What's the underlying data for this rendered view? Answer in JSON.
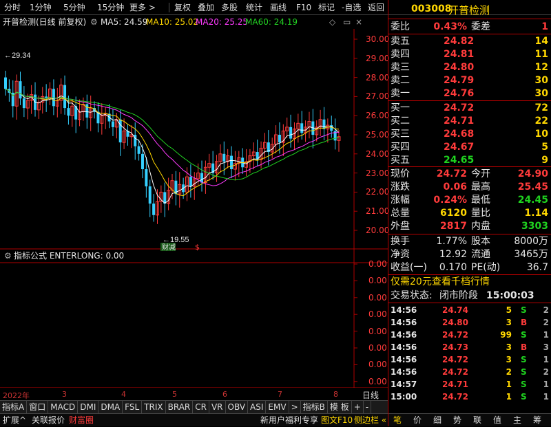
{
  "toolbar": {
    "left": [
      "分时",
      "1分钟",
      "5分钟",
      "15分钟",
      "更多 >"
    ],
    "right": [
      "复权",
      "叠加",
      "多股",
      "统计",
      "画线",
      "F10",
      "标记",
      "-自选",
      "返回"
    ]
  },
  "chart_title": {
    "name": "开普检测(日线 前复权)",
    "ma5": "MA5: 24.59",
    "ma10": "MA10: 25.02",
    "ma20": "MA20: 25.25",
    "ma60": "MA60: 24.19"
  },
  "price_axis": [
    "30.00",
    "29.00",
    "28.00",
    "27.00",
    "26.00",
    "25.00",
    "24.00",
    "23.00",
    "22.00",
    "21.00",
    "20.00"
  ],
  "annotations": {
    "high": "29.34",
    "low": "19.55",
    "marker_label": "财减",
    "marker_symbol": "$"
  },
  "indicator": {
    "title": "指标公式 ENTERLONG: 0.00",
    "axis": [
      "0.00",
      "0.00",
      "0.00",
      "0.00",
      "0.00",
      "0.00",
      "0.00",
      "0.00"
    ]
  },
  "date_axis": [
    "2022年",
    "3",
    "4",
    "5",
    "6",
    "7",
    "8"
  ],
  "date_mode": "日线",
  "tabs": [
    "指标A",
    "窗口",
    "MACD",
    "DMI",
    "DMA",
    "FSL",
    "TRIX",
    "BRAR",
    "CR",
    "VR",
    "OBV",
    "ASI",
    "EMV",
    ">",
    "指标B",
    "模 板",
    "+",
    "-"
  ],
  "bottom": {
    "left": [
      "扩展^",
      "关联报价",
      "财富圈"
    ],
    "promo": "新用户福利专享",
    "f10": "图文F10",
    "side": "侧边栏 «",
    "right_tabs": [
      "笔",
      "价",
      "细",
      "势",
      "联",
      "值",
      "主",
      "筹"
    ]
  },
  "quote": {
    "code": "003008",
    "name": "开普检测",
    "weibi_label": "委比",
    "weibi_value": "0.43%",
    "weicha_label": "委差",
    "weicha_value": "1",
    "sell": [
      {
        "label": "卖五",
        "price": "24.82",
        "vol": "14"
      },
      {
        "label": "卖四",
        "price": "24.81",
        "vol": "11"
      },
      {
        "label": "卖三",
        "price": "24.80",
        "vol": "12"
      },
      {
        "label": "卖二",
        "price": "24.79",
        "vol": "30"
      },
      {
        "label": "卖一",
        "price": "24.76",
        "vol": "30"
      }
    ],
    "buy": [
      {
        "label": "买一",
        "price": "24.72",
        "vol": "72"
      },
      {
        "label": "买二",
        "price": "24.71",
        "vol": "22"
      },
      {
        "label": "买三",
        "price": "24.68",
        "vol": "10"
      },
      {
        "label": "买四",
        "price": "24.67",
        "vol": "5"
      },
      {
        "label": "买五",
        "price": "24.65",
        "vol": "9"
      }
    ],
    "stats": [
      {
        "l1": "现价",
        "v1": "24.72",
        "l2": "今开",
        "v2": "24.90"
      },
      {
        "l1": "涨跌",
        "v1": "0.06",
        "l2": "最高",
        "v2": "25.45"
      },
      {
        "l1": "涨幅",
        "v1": "0.24%",
        "l2": "最低",
        "v2": "24.45"
      },
      {
        "l1": "总量",
        "v1": "6120",
        "l2": "量比",
        "v2": "1.14"
      },
      {
        "l1": "外盘",
        "v1": "2817",
        "l2": "内盘",
        "v2": "3303"
      }
    ],
    "fin": [
      {
        "l1": "换手",
        "v1": "1.77%",
        "l2": "股本",
        "v2": "8000万"
      },
      {
        "l1": "净资",
        "v1": "12.92",
        "l2": "流通",
        "v2": "3465万"
      },
      {
        "l1": "收益(一)",
        "v1": "0.170",
        "l2": "PE(动)",
        "v2": "36.7"
      }
    ],
    "promo": "仅需20元查看千档行情",
    "status_label": "交易状态:",
    "status_value": "闭市阶段",
    "status_time": "15:00:03",
    "ticks": [
      {
        "t": "14:56",
        "p": "24.74",
        "v": "5",
        "d": "S",
        "n": "2"
      },
      {
        "t": "14:56",
        "p": "24.80",
        "v": "3",
        "d": "B",
        "n": "2"
      },
      {
        "t": "14:56",
        "p": "24.72",
        "v": "99",
        "d": "S",
        "n": "1"
      },
      {
        "t": "14:56",
        "p": "24.73",
        "v": "3",
        "d": "B",
        "n": "3"
      },
      {
        "t": "14:56",
        "p": "24.72",
        "v": "3",
        "d": "S",
        "n": "1"
      },
      {
        "t": "14:56",
        "p": "24.72",
        "v": "2",
        "d": "S",
        "n": "2"
      },
      {
        "t": "14:57",
        "p": "24.71",
        "v": "1",
        "d": "S",
        "n": "1"
      },
      {
        "t": "15:00",
        "p": "24.72",
        "v": "1",
        "d": "S",
        "n": "1"
      }
    ]
  },
  "colors": {
    "up": "#ff3b3b",
    "down": "#1fd31f",
    "ma5": "#ffffff",
    "ma10": "#ffd700",
    "ma20": "#ff3bff",
    "ma60": "#22d322",
    "grid": "#b00000"
  }
}
